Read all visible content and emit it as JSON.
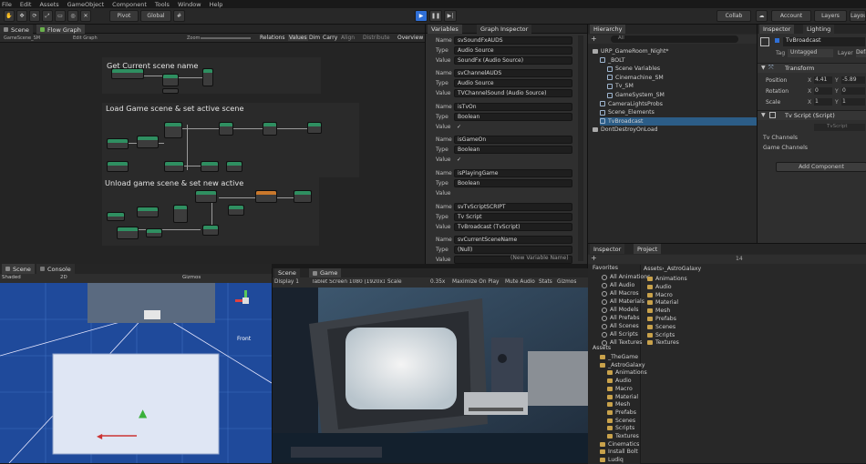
{
  "menu": [
    "File",
    "Edit",
    "Assets",
    "GameObject",
    "Component",
    "Tools",
    "Window",
    "Help"
  ],
  "toolbar": {
    "pivot": "Pivot",
    "global": "Global",
    "collab": "Collab",
    "account": "Account",
    "layers": "Layers",
    "layout": "Layout"
  },
  "graph_tabs": {
    "scene": "Scene",
    "flow": "Flow Graph"
  },
  "graph_toolbar": {
    "b1": "GameScene_SM",
    "b2": "Edit Graph",
    "b3": "Zoom",
    "relations": "Relations",
    "values": "Values",
    "dim": "Dim",
    "carry": "Carry",
    "align": "Align",
    "distribute": "Distribute",
    "overview": "Overview"
  },
  "graph_groups": [
    "Get Current scene name",
    "Load Game scene & set active scene",
    "Unload game scene & set new active"
  ],
  "var_tabs": {
    "vars": "Variables",
    "graph": "Graph Inspector"
  },
  "variables": [
    {
      "name": "svSoundFxAUDS",
      "type": "Audio Source",
      "value": "SoundFx (Audio Source)"
    },
    {
      "name": "svChannelAUDS",
      "type": "Audio Source",
      "value": "TVChannelSound (Audio Source)"
    },
    {
      "name": "isTvOn",
      "type": "Boolean",
      "value": "✓"
    },
    {
      "name": "isGameOn",
      "type": "Boolean",
      "value": "✓"
    },
    {
      "name": "isPlayingGame",
      "type": "Boolean",
      "value": ""
    },
    {
      "name": "svTvScriptSCRIPT",
      "type": "Tv Script",
      "value": "TvBroadcast (TvScript)"
    },
    {
      "name": "svCurrentSceneName",
      "type": "(Null)",
      "value": ""
    }
  ],
  "var_labels": {
    "name": "Name",
    "type": "Type",
    "value": "Value"
  },
  "new_variable": "(New Variable Name)",
  "hierarchy": {
    "title": "Hierarchy",
    "search": "All",
    "items": [
      {
        "label": "URP_GameRoom_Night*",
        "indent": 0,
        "icon": "scene"
      },
      {
        "label": "_BOLT",
        "indent": 1,
        "icon": "cube"
      },
      {
        "label": "Scene Variables",
        "indent": 2,
        "icon": "cube"
      },
      {
        "label": "Cinemachine_SM",
        "indent": 2,
        "icon": "cube"
      },
      {
        "label": "Tv_SM",
        "indent": 2,
        "icon": "cube"
      },
      {
        "label": "GameSystem_SM",
        "indent": 2,
        "icon": "cube"
      },
      {
        "label": "CameraLightsProbs",
        "indent": 1,
        "icon": "cube"
      },
      {
        "label": "Scene_Elements",
        "indent": 1,
        "icon": "cube"
      },
      {
        "label": "TvBroadcast",
        "indent": 1,
        "icon": "cube",
        "selected": true
      },
      {
        "label": "DontDestroyOnLoad",
        "indent": 0,
        "icon": "scene"
      }
    ]
  },
  "inspector": {
    "tabs": [
      "Inspector",
      "Lighting"
    ],
    "object_name": "TvBroadcast",
    "tag_label": "Tag",
    "tag": "Untagged",
    "layer_label": "Layer",
    "layer": "Default",
    "transform": "Transform",
    "position": {
      "label": "Position",
      "x": "4.41",
      "y": "-5.89"
    },
    "rotation": {
      "label": "Rotation",
      "x": "0",
      "y": "0"
    },
    "scale": {
      "label": "Scale",
      "x": "1",
      "y": "1"
    },
    "component": "Tv Script (Script)",
    "script_field": "TvScript",
    "tv_channels": "Tv Channels",
    "game_channels": "Game Channels",
    "add_component": "Add Component"
  },
  "project": {
    "tabs": [
      "Inspector",
      "Project"
    ],
    "count": "14",
    "favorites": "Favorites",
    "fav_items": [
      "All Animations",
      "All Audio",
      "All Macros",
      "All Materials",
      "All Models",
      "All Prefabs",
      "All Scenes",
      "All Scripts",
      "All Textures",
      "All Models",
      "All Prefabs"
    ],
    "breadcrumb_root": "Assets",
    "breadcrumb_child": "_AstroGalaxy",
    "folder_items": [
      "Animations",
      "Audio",
      "Macro",
      "Material",
      "Mesh",
      "Prefabs",
      "Scenes",
      "Scripts",
      "Textures"
    ],
    "assets": "Assets",
    "asset_tree": [
      "_TheGame",
      "_AstroGalaxy",
      "Animations",
      "Audio",
      "Macro",
      "Material",
      "Mesh",
      "Prefabs",
      "Scenes",
      "Scripts",
      "Textures",
      "Cinematics",
      "Install Bolt",
      "Ludiq"
    ]
  },
  "scene_tabs": {
    "scene": "Scene",
    "console": "Console",
    "shaded": "Shaded",
    "mode": "2D",
    "gizmos": "Gizmos",
    "front": "Front"
  },
  "game_tabs": {
    "scene": "Scene",
    "game": "Game",
    "display": "Display 1",
    "aspect": "Tablet Screen 1080 (1920x1200)",
    "scale_label": "Scale",
    "scale": "0.35x",
    "maximize": "Maximize On Play",
    "mute": "Mute Audio",
    "stats": "Stats",
    "gizmos": "Gizmos"
  },
  "colors": {
    "accent": "#2f6fd6",
    "node_green": "#2f8f61",
    "node_orange": "#c9782c",
    "selected": "#2c5d87"
  }
}
